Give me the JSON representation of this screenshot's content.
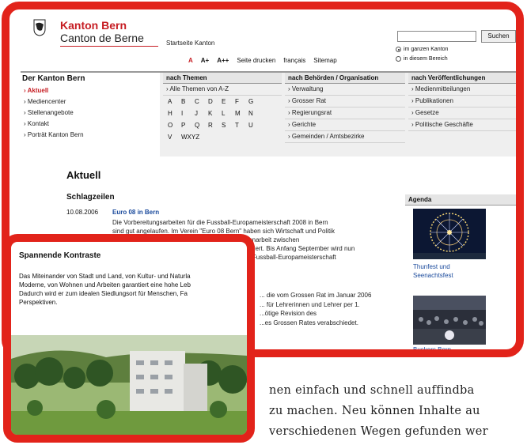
{
  "header": {
    "title_de": "Kanton Bern",
    "title_fr": "Canton de Berne",
    "startseite": "Startseite Kanton",
    "search_button": "Suchen",
    "search_value": "",
    "search_options": [
      "im ganzen Kanton",
      "in diesem Bereich"
    ],
    "font_sizes": [
      "A",
      "A+",
      "A++"
    ],
    "tools": [
      "Seite drucken",
      "français",
      "Sitemap"
    ]
  },
  "nav": {
    "left_title": "Der Kanton Bern",
    "left_items": [
      "Aktuell",
      "Mediencenter",
      "Stellenangebote",
      "Kontakt",
      "Porträt Kanton Bern"
    ],
    "col_themen": {
      "title": "nach Themen",
      "all_label": "Alle Themen von A-Z",
      "letters": [
        "A",
        "B",
        "C",
        "D",
        "E",
        "F",
        "G",
        "H",
        "I",
        "J",
        "K",
        "L",
        "M",
        "N",
        "O",
        "P",
        "Q",
        "R",
        "S",
        "T",
        "U",
        "V",
        "WXYZ"
      ]
    },
    "col_behoerden": {
      "title": "nach Behörden / Organisation",
      "items": [
        "Verwaltung",
        "Grosser Rat",
        "Regierungsrat",
        "Gerichte",
        "Gemeinden / Amtsbezirke"
      ]
    },
    "col_publ": {
      "title": "nach Veröffentlichungen",
      "items": [
        "Medienmitteilungen",
        "Publikationen",
        "Gesetze",
        "Politische Geschäfte"
      ]
    }
  },
  "main": {
    "heading": "Aktuell",
    "subheading": "Schlagzeilen",
    "news_date": "10.08.2006",
    "news_title": "Euro 08 in Bern",
    "news_lines": [
      "Die Vorbereitungsarbeiten für die Fussball-Europameisterschaft 2008 in Bern",
      "sind gut angelaufen. Im Verein \"Euro 08 Bern\" haben sich Wirtschaft und Politik",
      "... Die Zusammenarbeit zwischen",
      "...viert. Bis Anfang September wird nun",
      "... Fussball-Europameisterschaft"
    ],
    "news2_lines": [
      "... die vom Grossen Rat im Januar 2006",
      "... für Lehrerinnen und Lehrer per 1.",
      "...ötige Revision des",
      "...es Grossen Rates verabschiedet."
    ]
  },
  "agenda": {
    "title": "Agenda",
    "item1": [
      "Thunfest und",
      "Seenachtsfest"
    ],
    "item2": "Buskers Bern"
  },
  "overlay": {
    "title": "Spannende Kontraste",
    "lines": [
      "Das Miteinander von Stadt und Land, von Kultur- und Naturla",
      "Moderne, von Wohnen und Arbeiten garantiert eine hohe Leb",
      "Dadurch wird er zum idealen Siedlungsort für Menschen, Fa",
      "Perspektiven."
    ]
  },
  "tail_text": [
    "nen einfach und schnell auffindba",
    "zu machen. Neu können Inhalte au",
    "verschiedenen Wegen gefunden wer"
  ],
  "colors": {
    "frame": "#e2231a",
    "brand_red": "#c61d23",
    "link_blue": "#1a4a9c"
  }
}
